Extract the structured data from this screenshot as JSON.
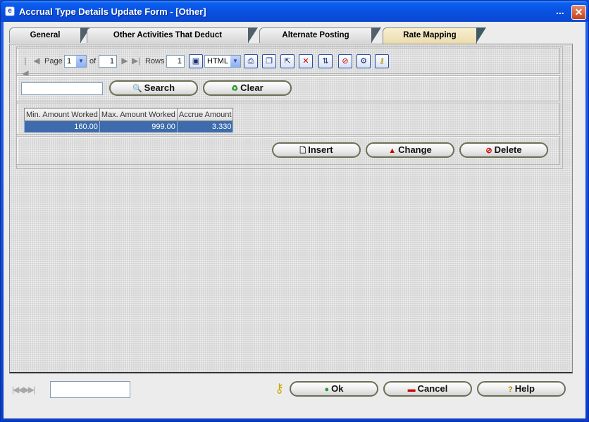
{
  "window": {
    "title": "Accrual Type Details Update Form - [Other]",
    "title_dots": "...",
    "close_glyph": "✕"
  },
  "tabs": [
    {
      "label": "General",
      "active": false
    },
    {
      "label": "Other Activities That Deduct",
      "active": false
    },
    {
      "label": "Alternate Posting",
      "active": false
    },
    {
      "label": "Rate Mapping",
      "active": true
    }
  ],
  "toolbar": {
    "page_label": "Page",
    "page_value": "1",
    "of_label": "of",
    "of_value": "1",
    "rows_label": "Rows",
    "rows_value": "1",
    "format_value": "HTML",
    "icons": [
      "save-icon",
      "print-icon",
      "copy-icon",
      "export-icon",
      "delete-record-icon",
      "sort-icon",
      "clear-sort-icon",
      "settings-icon",
      "key-tool-icon"
    ]
  },
  "search": {
    "input_value": "",
    "search_label": "Search",
    "clear_label": "Clear"
  },
  "grid": {
    "columns": [
      "Min. Amount Worked",
      "Max. Amount Worked",
      "Accrue Amount"
    ],
    "rows": [
      [
        "160.00",
        "999.00",
        "3.330"
      ]
    ]
  },
  "actions": {
    "insert_label": "Insert",
    "change_label": "Change",
    "delete_label": "Delete"
  },
  "footer": {
    "nav_input_value": "",
    "ok_label": "Ok",
    "cancel_label": "Cancel",
    "help_label": "Help"
  },
  "colors": {
    "title_bar": "#0a5ff0",
    "selected_row": "#3d6bab",
    "active_tab": "#eadcae"
  }
}
